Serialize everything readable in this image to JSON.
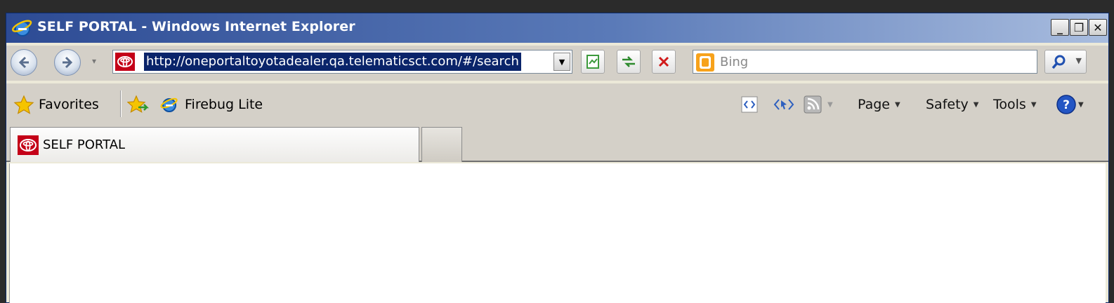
{
  "window": {
    "title": "SELF PORTAL - Windows Internet Explorer"
  },
  "window_controls": {
    "minimize": "_",
    "maximize": "❐",
    "close": "✕"
  },
  "address_bar": {
    "url": "http://oneportaltoyotadealer.qa.telematicsct.com/#/search"
  },
  "search": {
    "placeholder": "Bing"
  },
  "favorites_bar": {
    "favorites_label": "Favorites",
    "items": [
      "Firebug Lite"
    ]
  },
  "command_bar": {
    "page": "Page",
    "safety": "Safety",
    "tools": "Tools"
  },
  "tabs": [
    {
      "label": "SELF PORTAL"
    }
  ],
  "colors": {
    "titlebar_start": "#2d4b94",
    "titlebar_end": "#a9bddf",
    "toolbar_bg": "#d4d0c8",
    "url_highlight": "#0a246a",
    "toyota_red": "#c40018",
    "bing_orange": "#f7a21b"
  }
}
